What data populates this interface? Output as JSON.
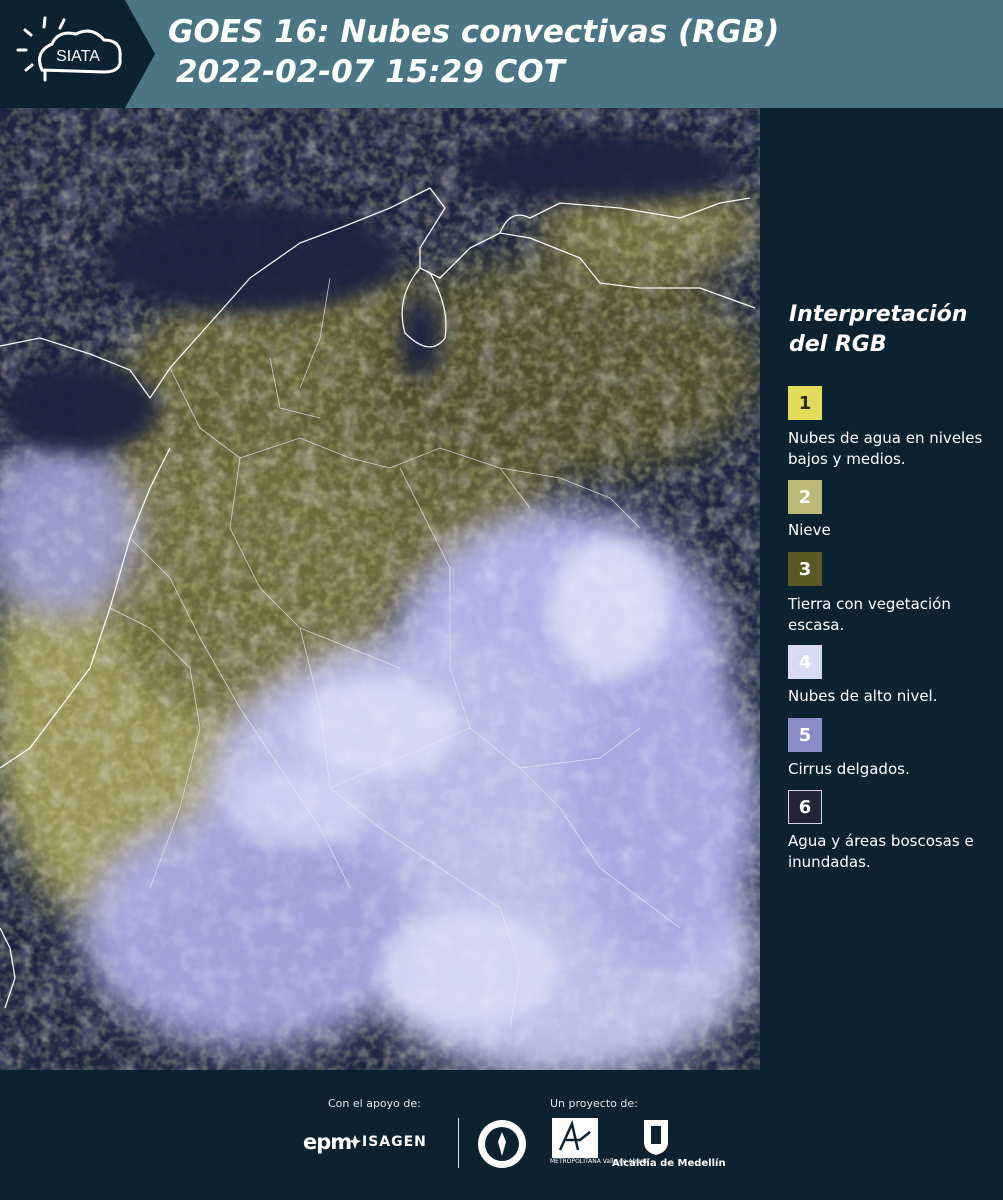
{
  "header": {
    "logo_text": "SIATA",
    "title_line1": "GOES 16: Nubes convectivas (RGB)",
    "title_line2": "2022-02-07 15:29 COT"
  },
  "legend": {
    "title": "Interpretación del RGB",
    "items": [
      {
        "number": "1",
        "label": "Nubes de agua en niveles bajos y medios.",
        "color": "#e1dc5c"
      },
      {
        "number": "2",
        "label": "Nieve",
        "color": "#bcb878"
      },
      {
        "number": "3",
        "label": "Tierra con vegetación escasa.",
        "color": "#5c5826"
      },
      {
        "number": "4",
        "label": "Nubes de alto nivel.",
        "color": "#d9dbf5"
      },
      {
        "number": "5",
        "label": "Cirrus delgados.",
        "color": "#8c8cc8"
      },
      {
        "number": "6",
        "label": "Agua y áreas boscosas e inundadas.",
        "color": "#23243a"
      }
    ]
  },
  "footer": {
    "support_label": "Con el apoyo de:",
    "project_label": "Un proyecto de:",
    "sponsors": [
      "epm",
      "ISAGEN"
    ],
    "partners": [
      "METROPOLITANA Valle de Aburrá",
      "Alcaldía de Medellín"
    ]
  },
  "colors": {
    "header_bg": "#4a7684",
    "page_bg": "#0c2230",
    "map_dark": "#1d2540",
    "cloud_high": "#c9c9f3",
    "cloud_low": "#c7c061",
    "land": "#4a4a2a"
  }
}
